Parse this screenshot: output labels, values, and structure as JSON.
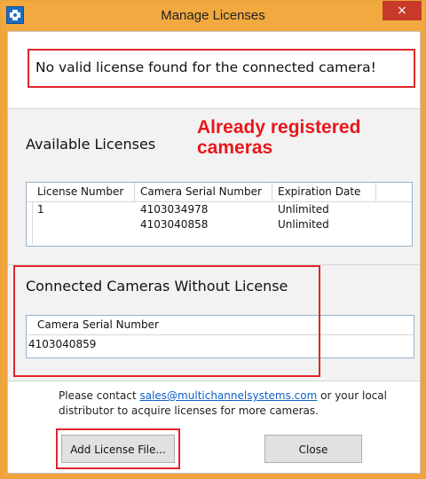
{
  "window": {
    "title": "Manage Licenses",
    "close_glyph": "×"
  },
  "error": {
    "message": "No valid license found for the connected camera!"
  },
  "available_licenses": {
    "title": "Available Licenses",
    "annotation_line1": "Already registered",
    "annotation_line2": "cameras",
    "columns": [
      "License Number",
      "Camera Serial Number",
      "Expiration Date"
    ],
    "rows": [
      {
        "license_number": "1",
        "camera_serial": "4103034978",
        "expiration": "Unlimited"
      },
      {
        "license_number": "",
        "camera_serial": "4103040858",
        "expiration": "Unlimited"
      }
    ]
  },
  "connected_cameras": {
    "title": "Connected Cameras Without License",
    "column": "Camera Serial Number",
    "rows": [
      {
        "camera_serial": "4103040859"
      }
    ]
  },
  "info": {
    "text_before": "Please contact ",
    "email": "sales@multichannelsystems.com",
    "text_after": " or your local distributor to acquire licenses for more cameras."
  },
  "buttons": {
    "add_license_label": "Add License File...",
    "close_label": "Close"
  },
  "colors": {
    "title_bar": "#f2a93f",
    "highlight": "#e0252a",
    "link": "#1060c8",
    "close_button": "#c7392a"
  },
  "icons": {
    "app_icon": "app-icon",
    "close_icon": "close-icon"
  }
}
